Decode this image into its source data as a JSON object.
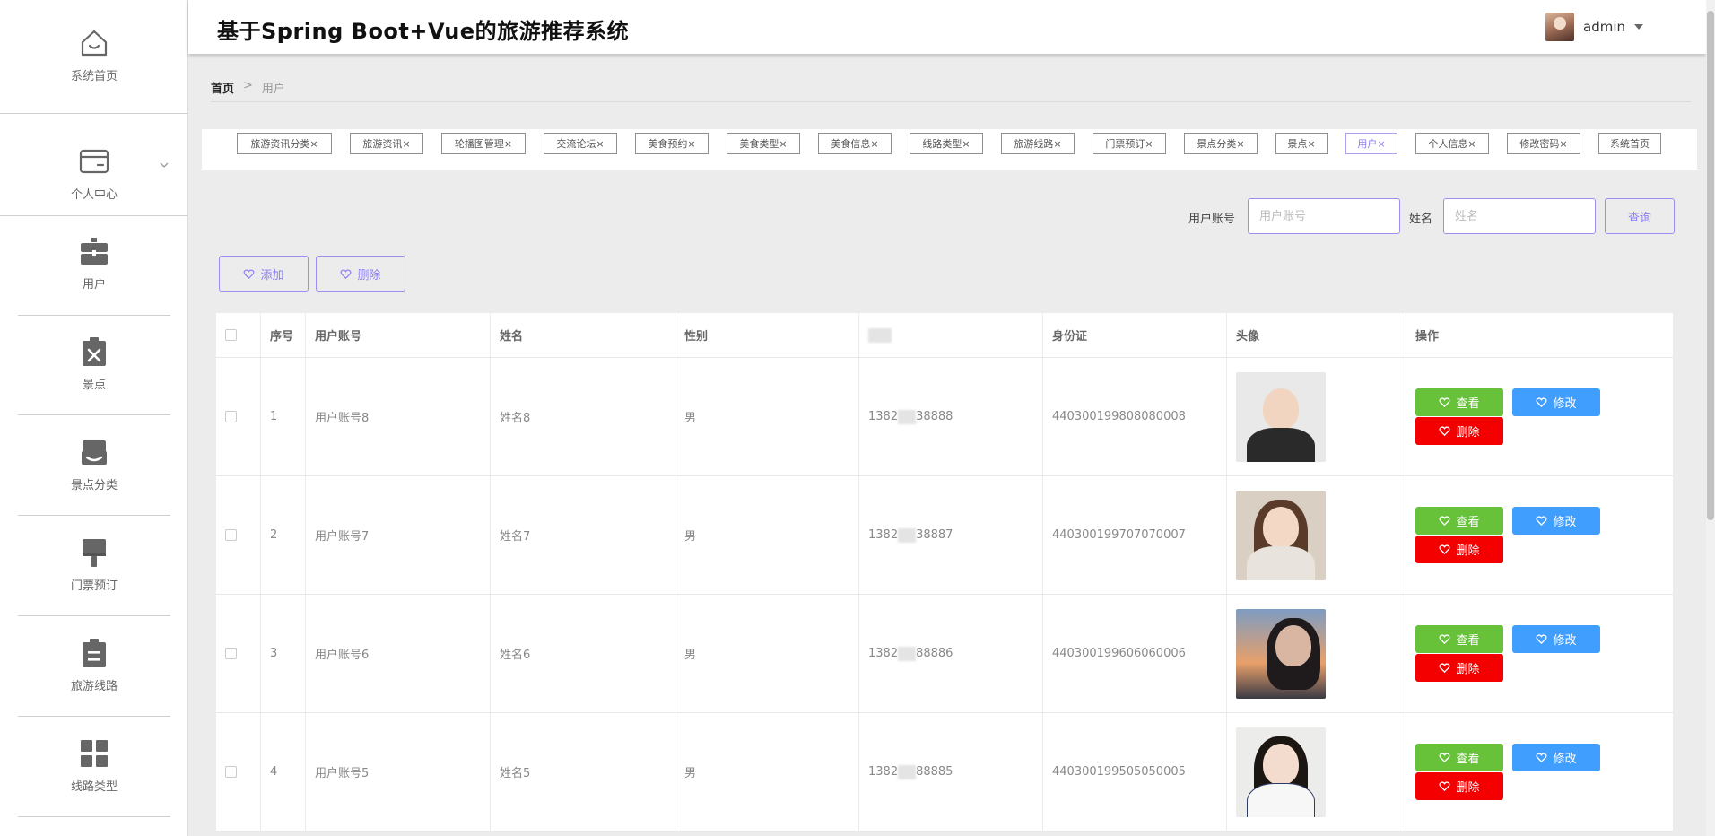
{
  "app": {
    "title": "基于Spring Boot+Vue的旅游推荐系统"
  },
  "user": {
    "name": "admin",
    "avatar_icon": "user-avatar"
  },
  "sidebar": {
    "items": [
      {
        "label": "系统首页",
        "icon": "home-icon"
      },
      {
        "label": "个人中心",
        "icon": "wallet-icon"
      },
      {
        "label": "用户",
        "icon": "briefcase-icon"
      },
      {
        "label": "景点",
        "icon": "clipboard-x-icon"
      },
      {
        "label": "景点分类",
        "icon": "store-icon"
      },
      {
        "label": "门票预订",
        "icon": "brush-icon"
      },
      {
        "label": "旅游线路",
        "icon": "clipboard-list-icon"
      },
      {
        "label": "线路类型",
        "icon": "grid-icon"
      }
    ]
  },
  "breadcrumb": {
    "home": "首页",
    "sep": ">",
    "current": "用户"
  },
  "tags": [
    "旅游资讯分类",
    "旅游资讯",
    "轮播图管理",
    "交流论坛",
    "美食预约",
    "美食类型",
    "美食信息",
    "线路类型",
    "旅游线路",
    "门票预订",
    "景点分类",
    "景点",
    "用户",
    "个人信息",
    "修改密码",
    "系统首页"
  ],
  "tag_close": "×",
  "active_tag": "用户",
  "search": {
    "account_label": "用户账号",
    "account_placeholder": "用户账号",
    "name_label": "姓名",
    "name_placeholder": "姓名",
    "query_label": "查询"
  },
  "actions": {
    "add_label": "添加",
    "delete_label": "删除"
  },
  "table": {
    "headers": {
      "index": "序号",
      "account": "用户账号",
      "name": "姓名",
      "gender": "性别",
      "phone": "",
      "idcard": "身份证",
      "avatar": "头像",
      "ops": "操作"
    },
    "rows": [
      {
        "index": "1",
        "account": "用户账号8",
        "name": "姓名8",
        "gender": "男",
        "phone_a": "1382",
        "phone_b": "38888",
        "idcard": "440300199808080008"
      },
      {
        "index": "2",
        "account": "用户账号7",
        "name": "姓名7",
        "gender": "男",
        "phone_a": "1382",
        "phone_b": "38887",
        "idcard": "440300199707070007"
      },
      {
        "index": "3",
        "account": "用户账号6",
        "name": "姓名6",
        "gender": "男",
        "phone_a": "1382",
        "phone_b": "88886",
        "idcard": "440300199606060006"
      },
      {
        "index": "4",
        "account": "用户账号5",
        "name": "姓名5",
        "gender": "男",
        "phone_a": "1382",
        "phone_b": "88885",
        "idcard": "440300199505050005"
      }
    ],
    "btn_view": "查看",
    "btn_edit": "修改",
    "btn_delete": "删除"
  },
  "colors": {
    "accent": "#8c7ff0",
    "view": "#67c23a",
    "edit": "#409eff",
    "delete": "#f50000"
  }
}
